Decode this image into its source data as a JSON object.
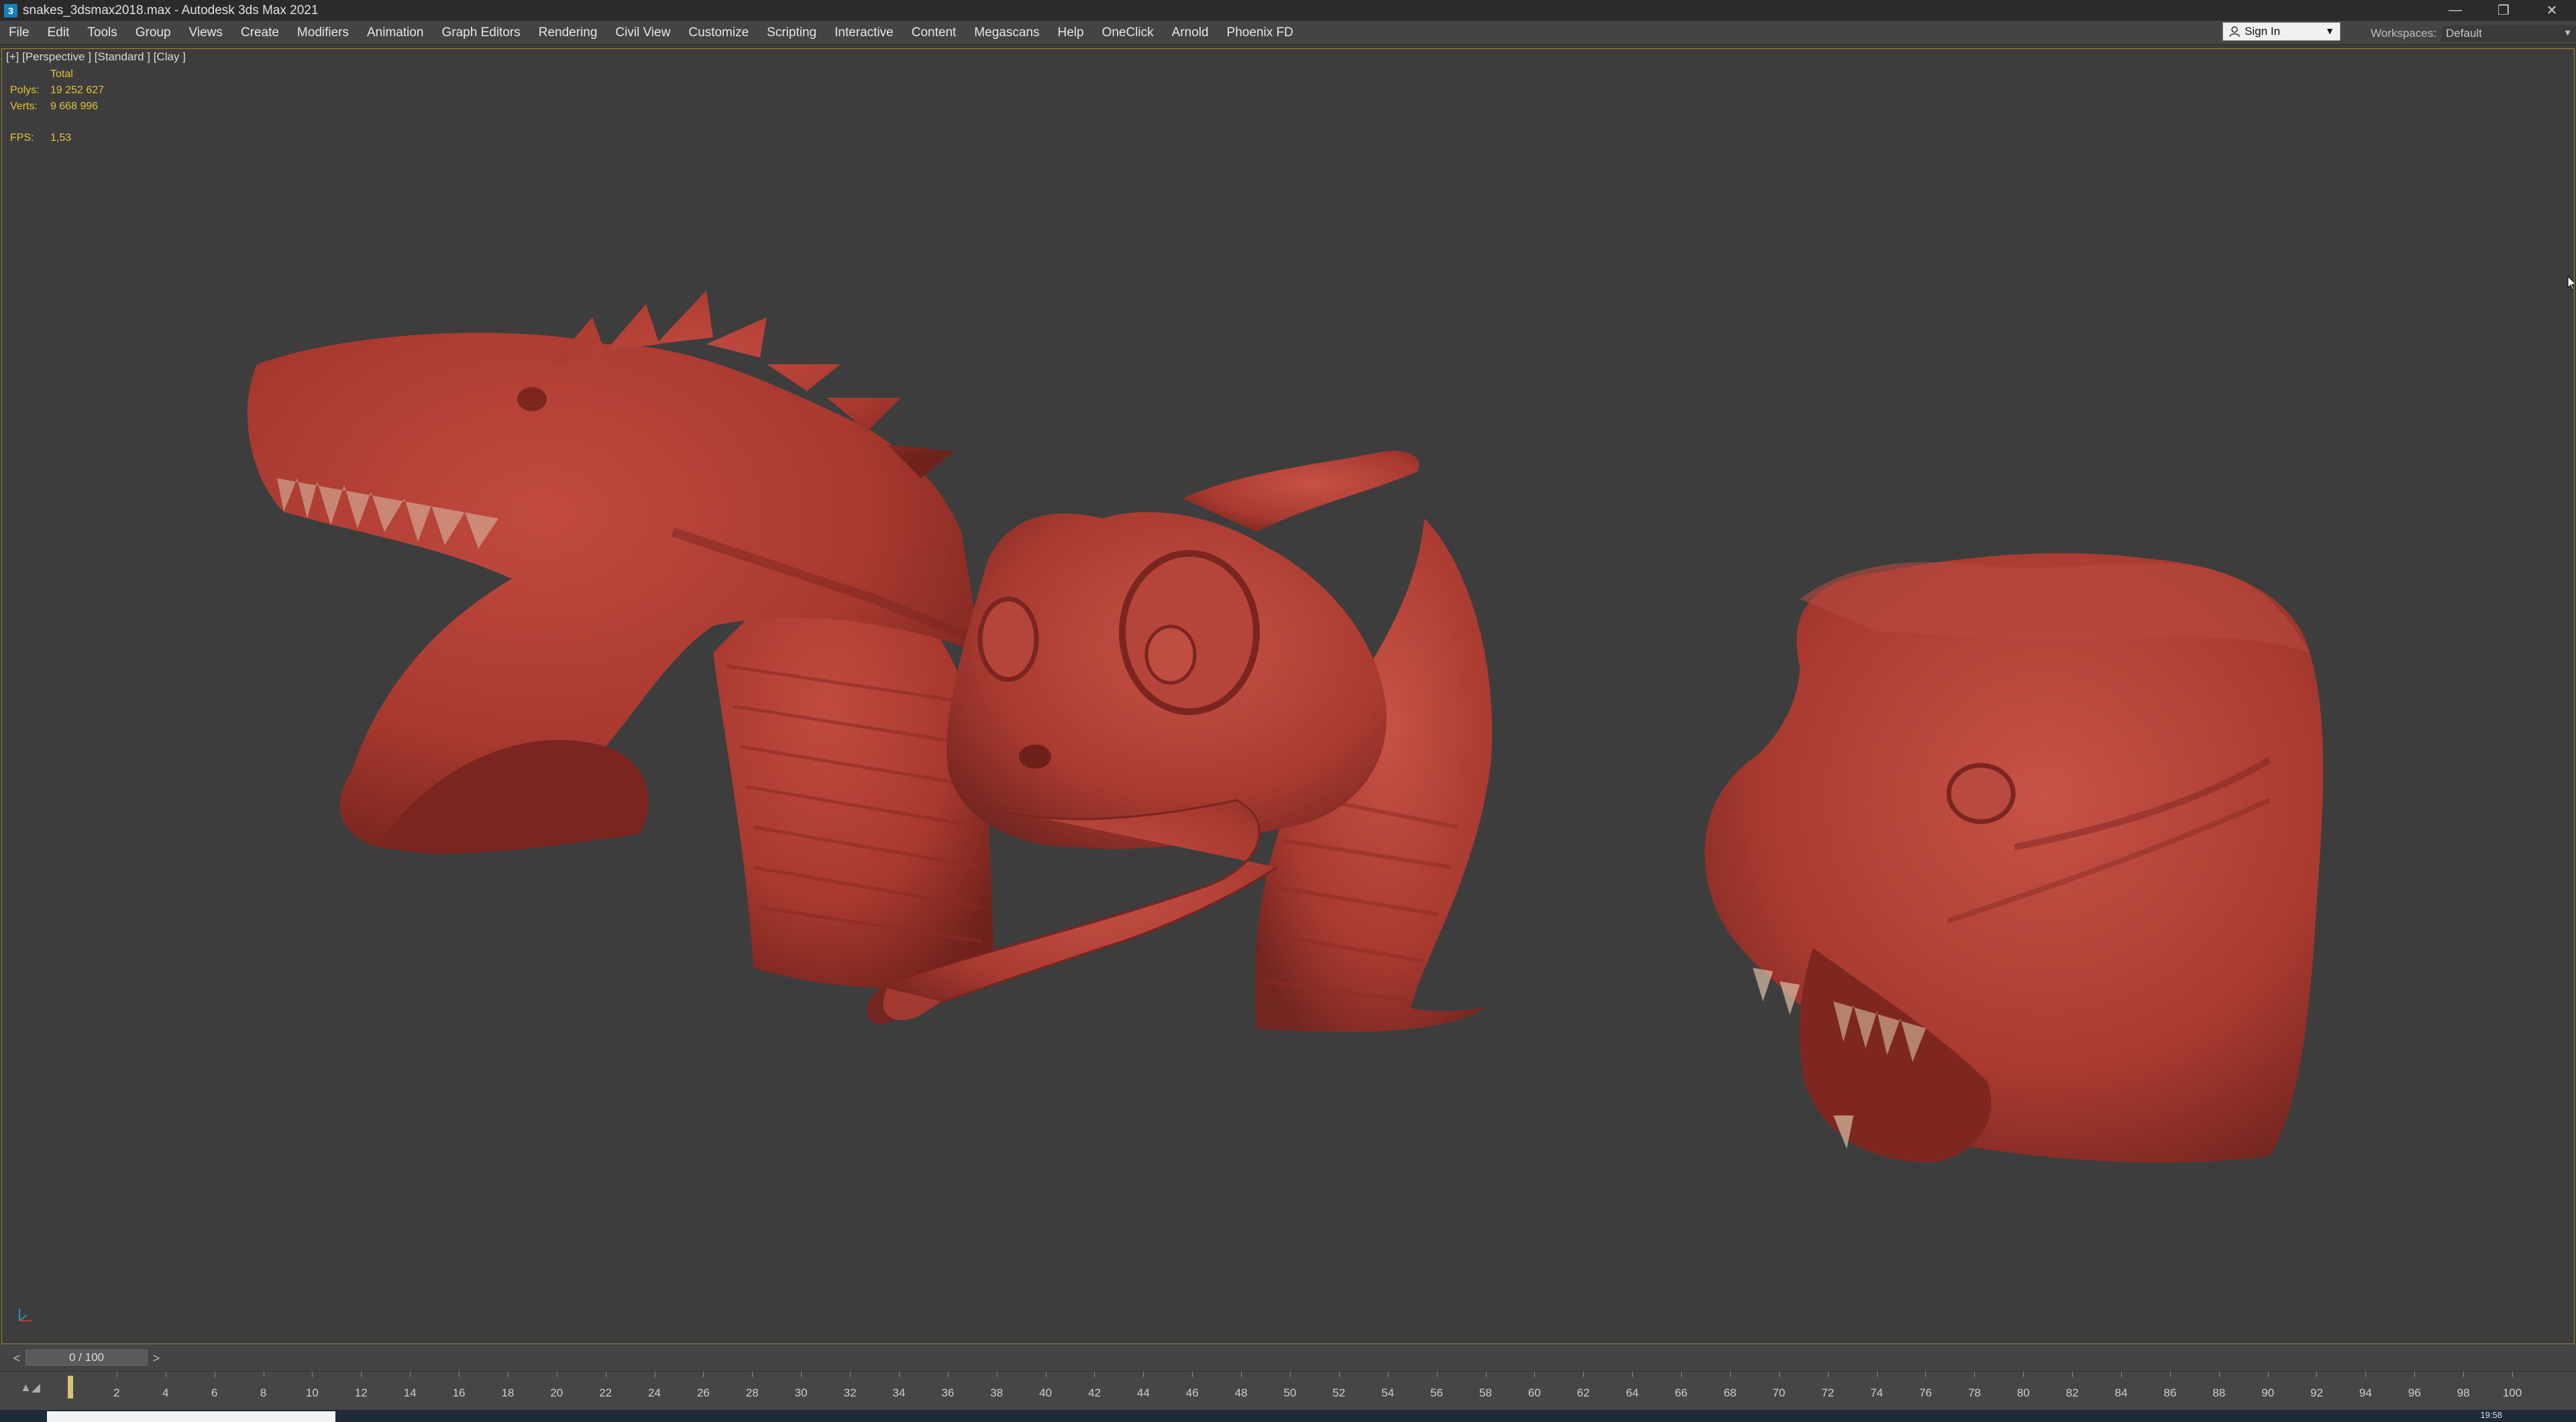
{
  "window": {
    "title": "snakes_3dsmax2018.max - Autodesk 3ds Max 2021",
    "app_icon": "3ds-max-icon",
    "controls": [
      "minimize-icon",
      "restore-icon",
      "close-icon"
    ]
  },
  "menubar": {
    "items": [
      "File",
      "Edit",
      "Tools",
      "Group",
      "Views",
      "Create",
      "Modifiers",
      "Animation",
      "Graph Editors",
      "Rendering",
      "Civil View",
      "Customize",
      "Scripting",
      "Interactive",
      "Content",
      "Megascans",
      "Help",
      "OneClick",
      "Arnold",
      "Phoenix FD"
    ],
    "sign_in": "Sign In",
    "workspaces_label": "Workspaces:",
    "workspaces_value": "Default"
  },
  "viewport": {
    "label": "[+] [Perspective ] [Standard ] [Clay ]",
    "stats": {
      "total_label": "Total",
      "polys_label": "Polys:",
      "polys_value": "19 252 627",
      "verts_label": "Verts:",
      "verts_value": "9 668 996",
      "fps_label": "FPS:",
      "fps_value": "1,53"
    },
    "clay_color": "#a8392f",
    "background_color": "#3d3d3d"
  },
  "timeslider": {
    "value": "0 / 100",
    "prev": "<",
    "next": ">",
    "current_frame": 0,
    "total_frames": 100
  },
  "trackbar": {
    "ticks": [
      "2",
      "4",
      "6",
      "8",
      "10",
      "12",
      "14",
      "16",
      "18",
      "20",
      "22",
      "24",
      "26",
      "28",
      "30",
      "32",
      "34",
      "36",
      "38",
      "40",
      "42",
      "44",
      "46",
      "48",
      "50",
      "52",
      "54",
      "56",
      "58",
      "60",
      "62",
      "64",
      "66",
      "68",
      "70",
      "72",
      "74",
      "76",
      "78",
      "80",
      "82",
      "84",
      "86",
      "88",
      "90",
      "92",
      "94",
      "96",
      "98",
      "100"
    ]
  },
  "taskbar": {
    "clock": "19:58"
  }
}
